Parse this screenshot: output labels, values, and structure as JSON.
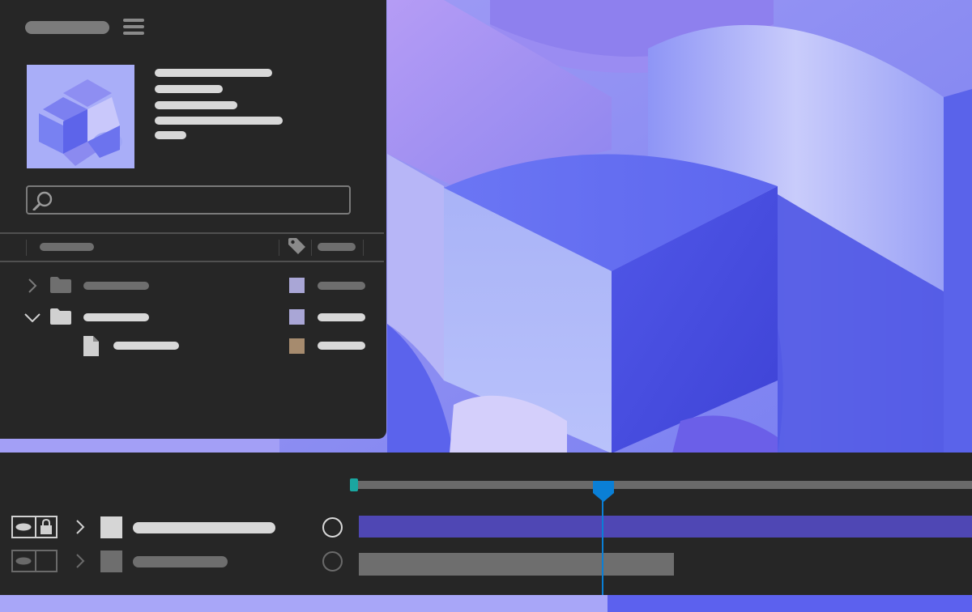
{
  "colors": {
    "panel_bg": "#262626",
    "accent_blue": "#0a7fd6",
    "accent_teal": "#1aa6a0",
    "clip_purple": "#4f47b4",
    "clip_gray": "#6e6e6e",
    "swatch_lavender": "#a9a6d6",
    "swatch_tan": "#a68b6e"
  },
  "icons": {
    "menu": "hamburger-menu-icon",
    "search": "magnifier-icon",
    "tag": "label-tag-icon",
    "folder": "folder-icon",
    "file": "file-icon",
    "chevron_right": "chevron-right-icon",
    "chevron_down": "chevron-down-icon",
    "visibility": "eye-icon",
    "lock": "padlock-icon",
    "keyframe": "circle-keyframe-icon",
    "playhead": "playhead-marker-icon"
  },
  "search": {
    "value": "",
    "placeholder": ""
  },
  "project_panel": {
    "tree_rows": [
      {
        "type": "folder",
        "expanded": false,
        "swatch": "#a9a6d6"
      },
      {
        "type": "folder",
        "expanded": true,
        "swatch": "#a9a6d6"
      },
      {
        "type": "file",
        "swatch": "#a68b6e"
      }
    ]
  },
  "timeline": {
    "layers": [
      {
        "visible": true,
        "locked": true,
        "selected": true,
        "clip_color": "#4f47b4"
      },
      {
        "visible": true,
        "locked": false,
        "selected": false,
        "clip_color": "#6e6e6e"
      }
    ]
  }
}
